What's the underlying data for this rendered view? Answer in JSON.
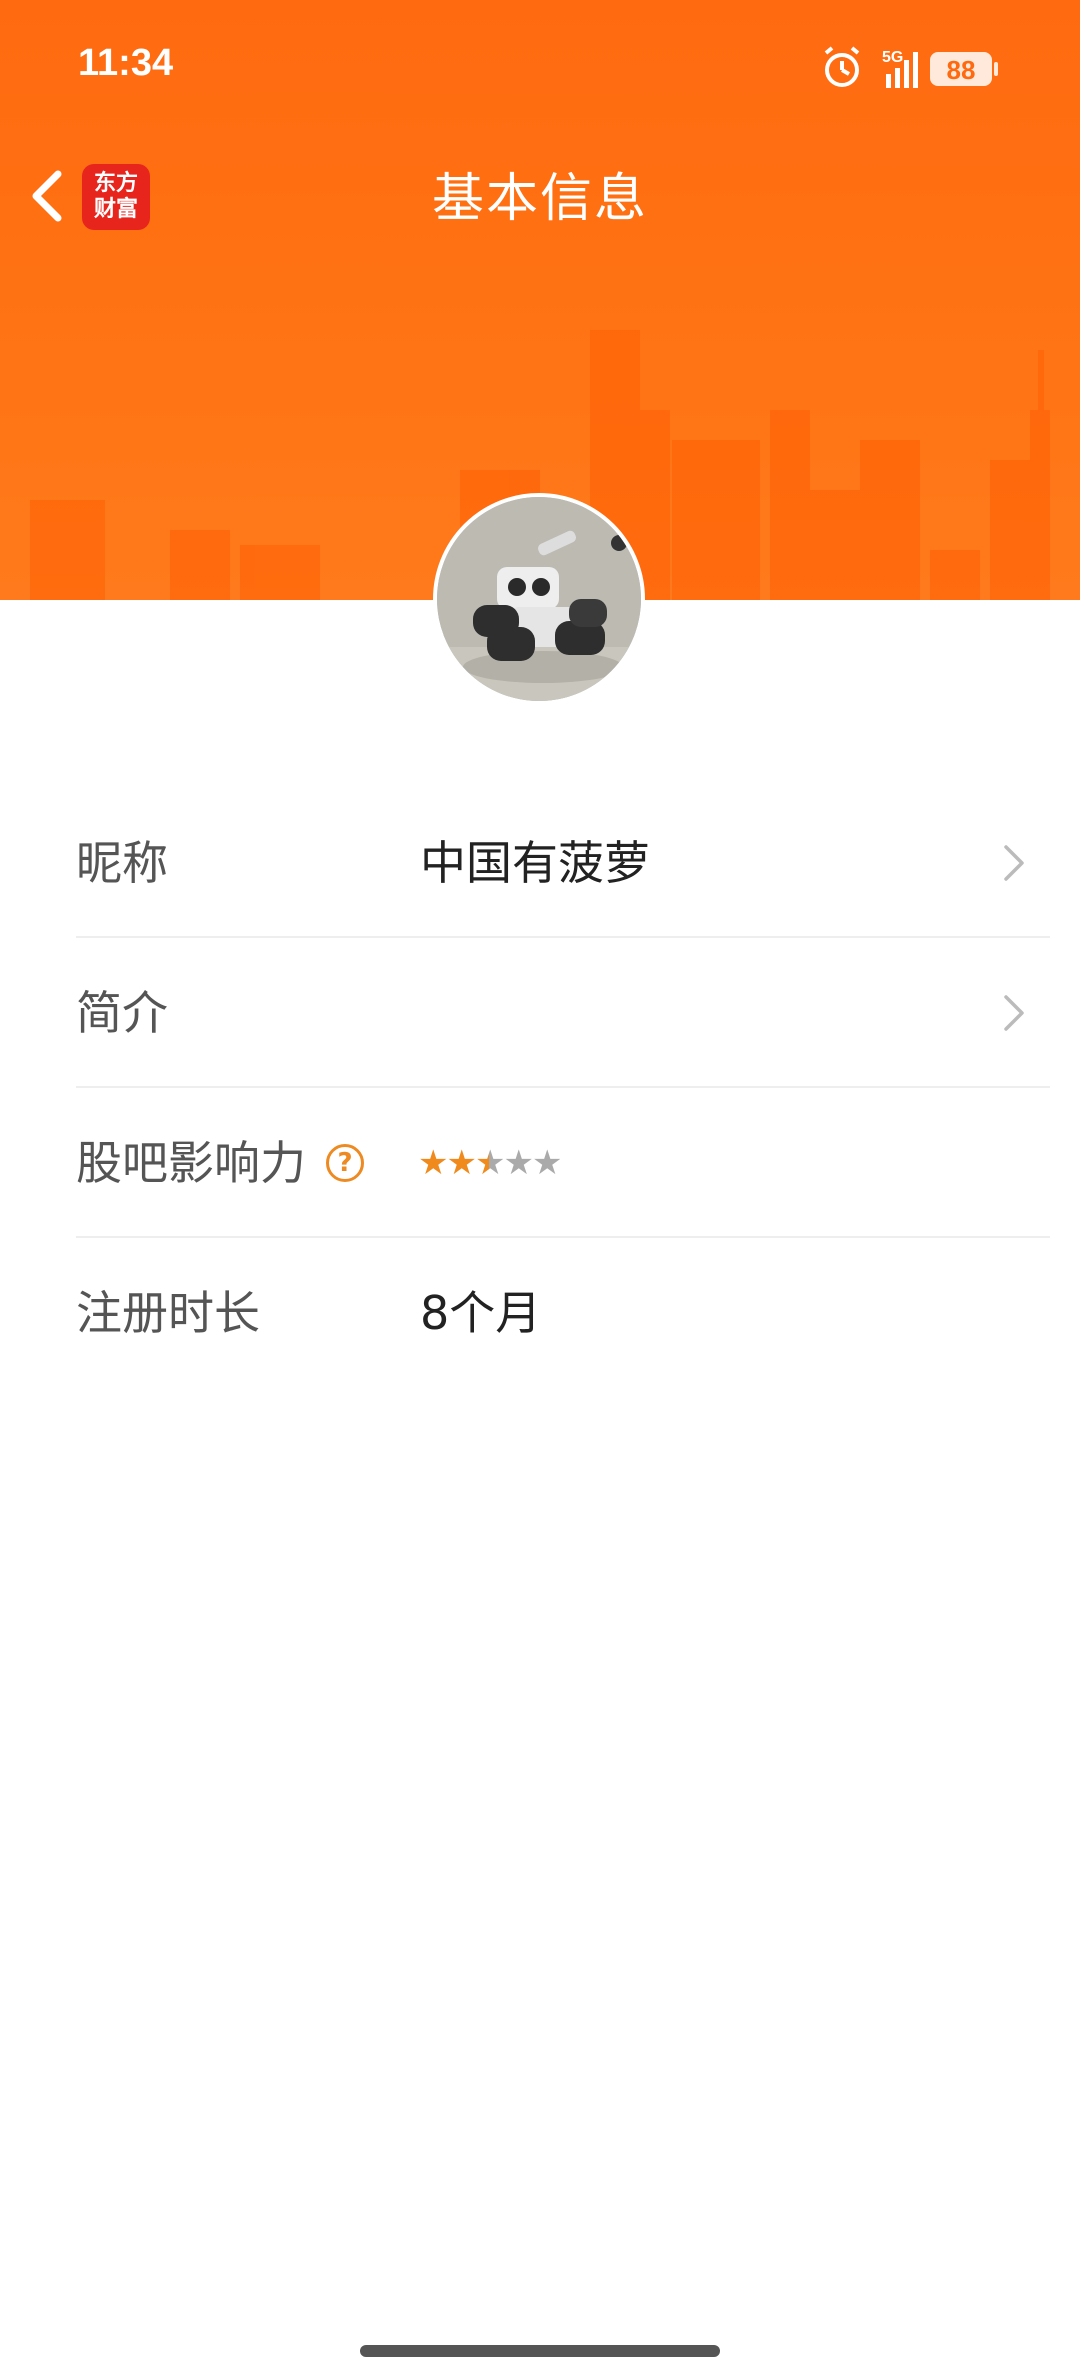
{
  "status_bar": {
    "time": "11:34",
    "network": "5G",
    "battery": "88",
    "icons": [
      "alarm-icon",
      "signal-icon",
      "battery-icon"
    ]
  },
  "nav": {
    "title": "基本信息",
    "logo_line1": "东方",
    "logo_line2": "财富",
    "back_icon": "chevron-left-icon"
  },
  "profile": {
    "avatar": "robot-toy-photo"
  },
  "rows": [
    {
      "label": "昵称",
      "value": "中国有菠萝",
      "has_chevron": true
    },
    {
      "label": "简介",
      "value": "",
      "has_chevron": true
    },
    {
      "label": "股吧影响力",
      "help_icon": "question-circle-icon",
      "stars_total": 5,
      "stars_filled": 2.5
    },
    {
      "label": "注册时长",
      "value": "8个月",
      "has_chevron": false
    }
  ],
  "colors": {
    "header": "#ff6a10",
    "accent": "#ee8a22",
    "logo": "#e8251d"
  }
}
